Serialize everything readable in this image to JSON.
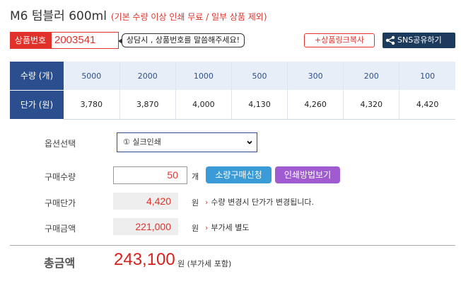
{
  "product": {
    "name": "M6 텀블러 600ml",
    "note": "(기본 수량 이상 인쇄 무료 / 일부 상품 제외)"
  },
  "code": {
    "label": "상품번호",
    "value": "2003541",
    "hint": "상담시 , 상품번호를 말씀해주세요!",
    "copy_link_label": "+상품링크복사",
    "sns_label": "SNS공유하기"
  },
  "price_table": {
    "qty_header": "수량 (개)",
    "price_header": "단가 (원)",
    "quantities": [
      "5000",
      "2000",
      "1000",
      "500",
      "300",
      "200",
      "100"
    ],
    "prices": [
      "3,780",
      "3,870",
      "4,000",
      "4,130",
      "4,260",
      "4,320",
      "4,420"
    ]
  },
  "form": {
    "option_label": "옵션선택",
    "option_selected": "① 실크인쇄",
    "qty_label": "구매수량",
    "qty_value": "50",
    "qty_unit": "개",
    "bulk_button": "소량구매신청",
    "print_button": "인쇄방법보기",
    "unit_price_label": "구매단가",
    "unit_price_value": "4,420",
    "won": "원",
    "unit_price_note": "수량 변경시 단가가 변경됩니다.",
    "amount_label": "구매금액",
    "amount_value": "221,000",
    "amount_note": "부가세 별도"
  },
  "total": {
    "label": "총금액",
    "value": "243,100",
    "suffix": "원 (부가세 포함)"
  },
  "colors": {
    "accent_red": "#e0322b",
    "table_header_blue": "#2b4f8e",
    "bulk_button_blue": "#3a9bd6",
    "print_button_purple": "#a05bd1",
    "sns_navy": "#1b3a5c"
  },
  "icons": {
    "share": "share-icon",
    "dropdown": "chevron-down-icon",
    "arrow": "chevron-right-icon"
  }
}
